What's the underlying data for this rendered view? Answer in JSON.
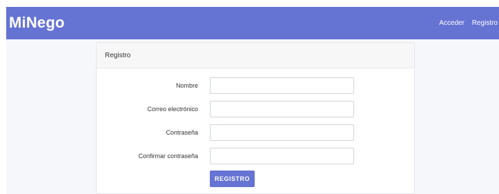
{
  "theme": {
    "accent": "#6573d3",
    "background": "#f5f7fa"
  },
  "navbar": {
    "brand": "MiNego",
    "links": [
      "Acceder",
      "Registro"
    ]
  },
  "card": {
    "title": "Registro",
    "fields": [
      {
        "label": "Nombre",
        "value": "",
        "placeholder": ""
      },
      {
        "label": "Correo electrónico",
        "value": "",
        "placeholder": ""
      },
      {
        "label": "Contraseña",
        "value": "",
        "placeholder": ""
      },
      {
        "label": "Confirmar contraseña",
        "value": "",
        "placeholder": ""
      }
    ],
    "submit_label": "REGISTRO"
  }
}
